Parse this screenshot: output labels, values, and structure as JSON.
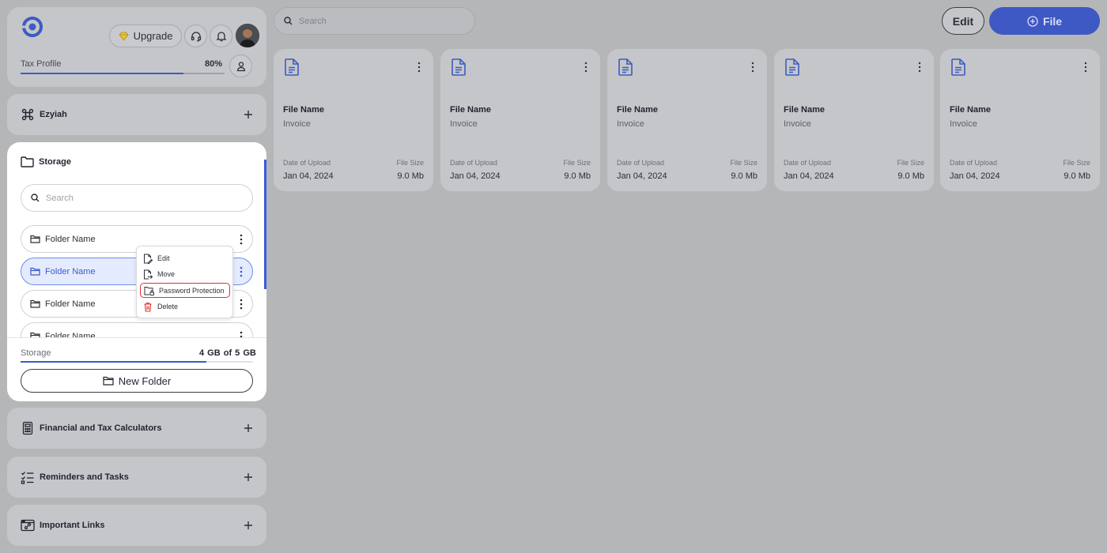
{
  "colors": {
    "accent": "#3d5bc4",
    "highlight_outline": "#e03131",
    "delete_icon": "#e03131"
  },
  "profile": {
    "upgrade_label": "Upgrade",
    "tax_profile_label": "Tax Profile",
    "tax_profile_percent": "80%",
    "tax_profile_progress": 0.8
  },
  "sidebar": {
    "top_item": {
      "label": "Ezyiah",
      "icon": "command-icon"
    },
    "storage": {
      "title": "Storage",
      "search_placeholder": "Search",
      "folders": [
        {
          "label": "Folder Name",
          "active": false
        },
        {
          "label": "Folder Name",
          "active": true
        },
        {
          "label": "Folder Name",
          "active": false
        },
        {
          "label": "Folder Name",
          "active": false
        }
      ],
      "usage_label": "Storage",
      "usage_text": "4 GB of 5  GB",
      "usage_fraction": 0.8,
      "new_folder_label": "New Folder"
    },
    "bottom_items": [
      {
        "label": "Financial and Tax Calculators",
        "icon": "calculator-icon"
      },
      {
        "label": "Reminders and Tasks",
        "icon": "checklist-icon"
      },
      {
        "label": "Important Links",
        "icon": "link-window-icon"
      }
    ]
  },
  "context_menu": {
    "items": [
      {
        "label": "Edit",
        "icon": "edit-file-icon"
      },
      {
        "label": "Move",
        "icon": "move-file-icon"
      },
      {
        "label": "Password Protection",
        "icon": "lock-folder-icon"
      },
      {
        "label": "Delete",
        "icon": "trash-icon"
      }
    ]
  },
  "topbar": {
    "search_placeholder": "Search",
    "edit_label": "Edit",
    "file_label": "File"
  },
  "files": [
    {
      "name": "File Name",
      "type": "Invoice",
      "date_label": "Date of Upload",
      "date": "Jan 04, 2024",
      "size_label": "File Size",
      "size": "9.0 Mb"
    },
    {
      "name": "File Name",
      "type": "Invoice",
      "date_label": "Date of Upload",
      "date": "Jan 04, 2024",
      "size_label": "File Size",
      "size": "9.0 Mb"
    },
    {
      "name": "File Name",
      "type": "Invoice",
      "date_label": "Date of Upload",
      "date": "Jan 04, 2024",
      "size_label": "File Size",
      "size": "9.0 Mb"
    },
    {
      "name": "File Name",
      "type": "Invoice",
      "date_label": "Date of Upload",
      "date": "Jan 04, 2024",
      "size_label": "File Size",
      "size": "9.0 Mb"
    },
    {
      "name": "File Name",
      "type": "Invoice",
      "date_label": "Date of Upload",
      "date": "Jan 04, 2024",
      "size_label": "File Size",
      "size": "9.0 Mb"
    }
  ]
}
